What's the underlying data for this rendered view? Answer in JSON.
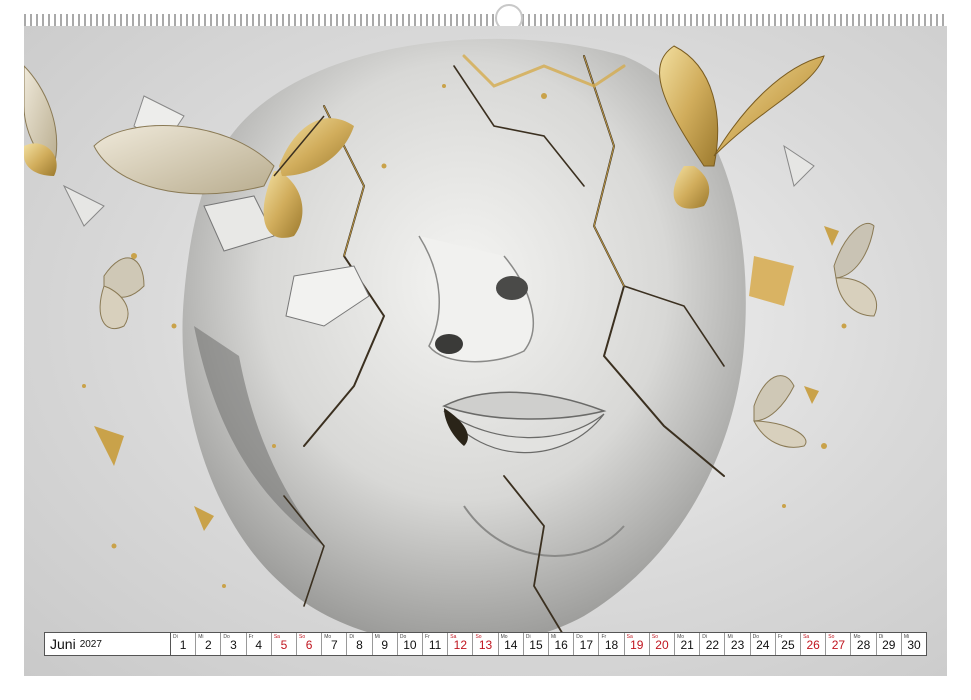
{
  "calendar": {
    "month": "Juni",
    "year": "2027",
    "days": [
      {
        "wd": "Di",
        "d": "1",
        "weekend": false
      },
      {
        "wd": "Mi",
        "d": "2",
        "weekend": false
      },
      {
        "wd": "Do",
        "d": "3",
        "weekend": false
      },
      {
        "wd": "Fr",
        "d": "4",
        "weekend": false
      },
      {
        "wd": "Sa",
        "d": "5",
        "weekend": true
      },
      {
        "wd": "So",
        "d": "6",
        "weekend": true
      },
      {
        "wd": "Mo",
        "d": "7",
        "weekend": false
      },
      {
        "wd": "Di",
        "d": "8",
        "weekend": false
      },
      {
        "wd": "Mi",
        "d": "9",
        "weekend": false
      },
      {
        "wd": "Do",
        "d": "10",
        "weekend": false
      },
      {
        "wd": "Fr",
        "d": "11",
        "weekend": false
      },
      {
        "wd": "Sa",
        "d": "12",
        "weekend": true
      },
      {
        "wd": "So",
        "d": "13",
        "weekend": true
      },
      {
        "wd": "Mo",
        "d": "14",
        "weekend": false
      },
      {
        "wd": "Di",
        "d": "15",
        "weekend": false
      },
      {
        "wd": "Mi",
        "d": "16",
        "weekend": false
      },
      {
        "wd": "Do",
        "d": "17",
        "weekend": false
      },
      {
        "wd": "Fr",
        "d": "18",
        "weekend": false
      },
      {
        "wd": "Sa",
        "d": "19",
        "weekend": true
      },
      {
        "wd": "So",
        "d": "20",
        "weekend": true
      },
      {
        "wd": "Mo",
        "d": "21",
        "weekend": false
      },
      {
        "wd": "Di",
        "d": "22",
        "weekend": false
      },
      {
        "wd": "Mi",
        "d": "23",
        "weekend": false
      },
      {
        "wd": "Do",
        "d": "24",
        "weekend": false
      },
      {
        "wd": "Fr",
        "d": "25",
        "weekend": false
      },
      {
        "wd": "Sa",
        "d": "26",
        "weekend": true
      },
      {
        "wd": "So",
        "d": "27",
        "weekend": true
      },
      {
        "wd": "Mo",
        "d": "28",
        "weekend": false
      },
      {
        "wd": "Di",
        "d": "29",
        "weekend": false
      },
      {
        "wd": "Mi",
        "d": "30",
        "weekend": false
      }
    ]
  },
  "colors": {
    "weekend": "#c0141e",
    "gold": "#c9a24a",
    "marble": "#e6e6e4",
    "background": "#d4d4d4"
  },
  "artwork": {
    "subject": "cracked-marble-face-with-golden-butterflies"
  }
}
